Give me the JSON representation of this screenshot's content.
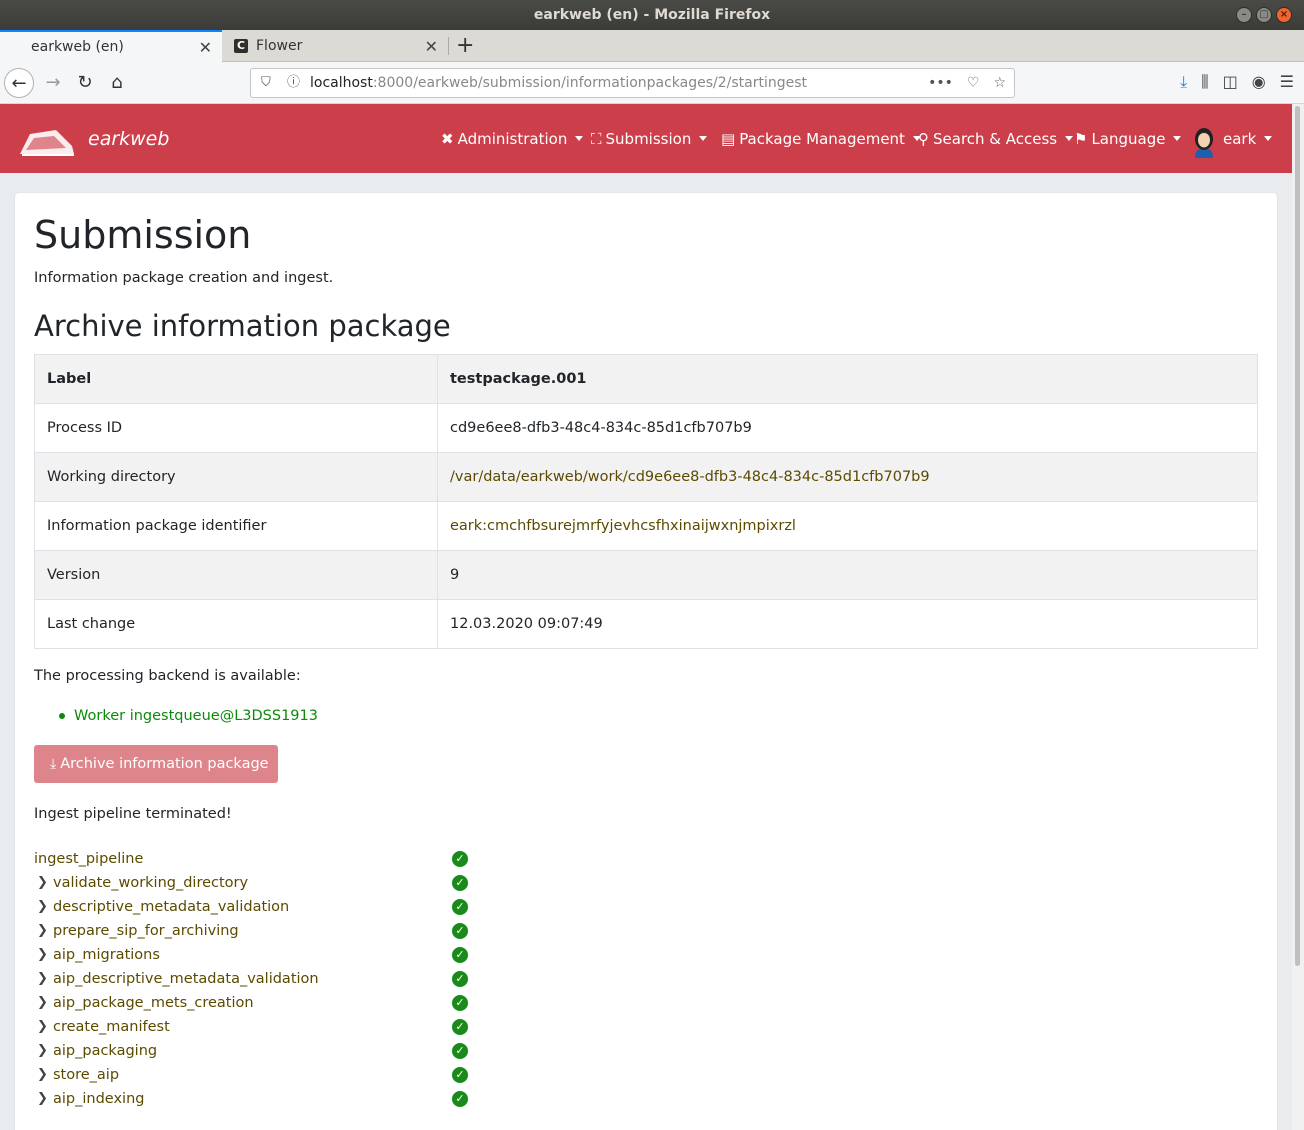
{
  "window": {
    "title": "earkweb (en) - Mozilla Firefox"
  },
  "browser": {
    "tabs": [
      {
        "label": "earkweb (en)",
        "active": true
      },
      {
        "label": "Flower",
        "active": false
      }
    ],
    "url": {
      "host": "localhost",
      "rest": ":8000/earkweb/submission/informationpackages/2/startingest"
    }
  },
  "app": {
    "brand": "earkweb",
    "accent_color": "#cc3f4a",
    "menu": [
      {
        "icon": "tools-icon",
        "label": "Administration"
      },
      {
        "icon": "sitemap-icon",
        "label": "Submission"
      },
      {
        "icon": "archive-box-icon",
        "label": "Package Management"
      },
      {
        "icon": "search-icon",
        "label": "Search & Access"
      },
      {
        "icon": "flag-icon",
        "label": "Language"
      }
    ],
    "user": "eark"
  },
  "page": {
    "title": "Submission",
    "subtitle": "Information package creation and ingest.",
    "section_title": "Archive information package",
    "table": [
      [
        "Label",
        "testpackage.001"
      ],
      [
        "Process ID",
        "cd9e6ee8-dfb3-48c4-834c-85d1cfb707b9"
      ],
      [
        "Working directory",
        "/var/data/earkweb/work/cd9e6ee8-dfb3-48c4-834c-85d1cfb707b9"
      ],
      [
        "Information package identifier",
        "eark:cmchfbsurejmrfyjevhcsfhxinaijwxnjmpixrzl"
      ],
      [
        "Version",
        "9"
      ],
      [
        "Last change",
        "12.03.2020 09:07:49"
      ]
    ],
    "backend_text": "The processing backend is available:",
    "worker": "Worker ingestqueue@L3DSS1913",
    "archive_button": "Archive information package",
    "ingest_status": "Ingest pipeline terminated!",
    "tasks": [
      "ingest_pipeline",
      "validate_working_directory",
      "descriptive_metadata_validation",
      "prepare_sip_for_archiving",
      "aip_migrations",
      "aip_descriptive_metadata_validation",
      "aip_package_mets_creation",
      "create_manifest",
      "aip_packaging",
      "store_aip",
      "aip_indexing"
    ]
  }
}
